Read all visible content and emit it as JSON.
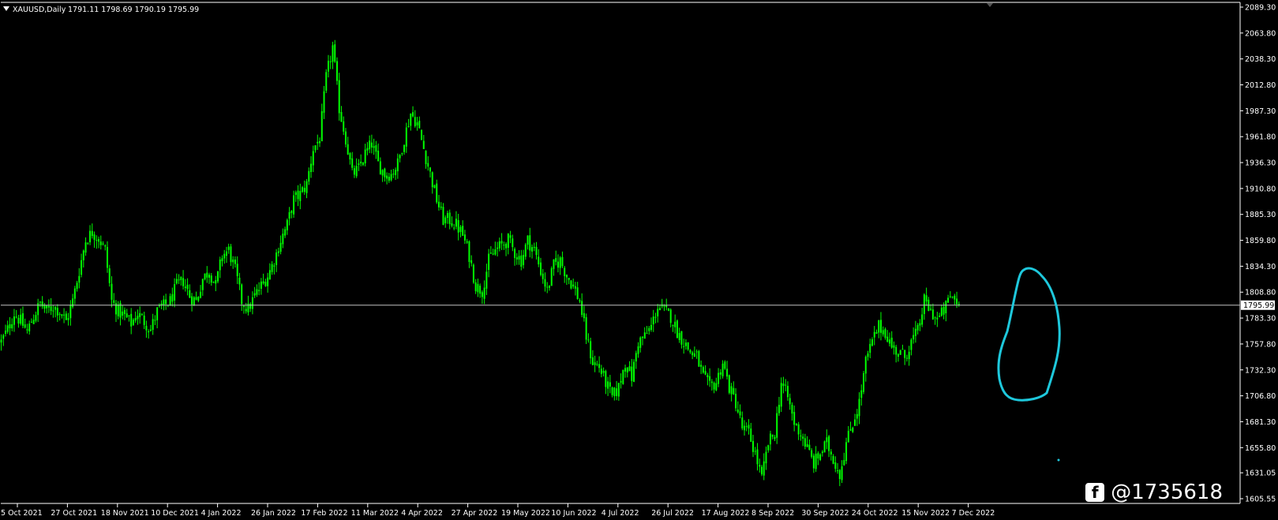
{
  "header": {
    "symbol_label": "XAUUSD,Daily",
    "ohlc": "1791.11 1798.69 1790.19 1795.99"
  },
  "watermark": {
    "text": "@1735618",
    "icon": "f"
  },
  "colors": {
    "background": "#000000",
    "candle": "#00ff00",
    "axis": "#ffffff",
    "current_line": "#c0c0c0",
    "drawing": "#1ec8dc",
    "price_box_bg": "#ffffff"
  },
  "chart_data": {
    "type": "candlestick",
    "symbol": "XAUUSD",
    "timeframe": "Daily",
    "current_price": 1795.99,
    "y_ticks": [
      "2089.30",
      "2063.80",
      "2038.30",
      "2012.80",
      "1987.30",
      "1961.80",
      "1936.30",
      "1910.80",
      "1885.30",
      "1859.80",
      "1834.30",
      "1808.80",
      "1783.30",
      "1757.80",
      "1732.30",
      "1706.80",
      "1681.30",
      "1655.80",
      "1631.05",
      "1605.55"
    ],
    "ylim": [
      1605.55,
      2089.3
    ],
    "x_ticks": [
      "5 Oct 2021",
      "27 Oct 2021",
      "18 Nov 2021",
      "10 Dec 2021",
      "4 Jan 2022",
      "26 Jan 2022",
      "17 Feb 2022",
      "11 Mar 2022",
      "4 Apr 2022",
      "27 Apr 2022",
      "19 May 2022",
      "10 Jun 2022",
      "4 Jul 2022",
      "26 Jul 2022",
      "17 Aug 2022",
      "8 Sep 2022",
      "30 Sep 2022",
      "24 Oct 2022",
      "15 Nov 2022",
      "7 Dec 2022"
    ],
    "close_path": [
      [
        0,
        1760
      ],
      [
        3,
        1772
      ],
      [
        6,
        1788
      ],
      [
        9,
        1780
      ],
      [
        12,
        1770
      ],
      [
        15,
        1785
      ],
      [
        18,
        1798
      ],
      [
        21,
        1790
      ],
      [
        24,
        1795
      ],
      [
        27,
        1790
      ],
      [
        30,
        1780
      ],
      [
        33,
        1800
      ],
      [
        36,
        1830
      ],
      [
        39,
        1860
      ],
      [
        42,
        1868
      ],
      [
        45,
        1862
      ],
      [
        48,
        1850
      ],
      [
        51,
        1800
      ],
      [
        54,
        1790
      ],
      [
        57,
        1785
      ],
      [
        60,
        1778
      ],
      [
        63,
        1788
      ],
      [
        66,
        1780
      ],
      [
        69,
        1772
      ],
      [
        72,
        1790
      ],
      [
        75,
        1795
      ],
      [
        78,
        1800
      ],
      [
        81,
        1815
      ],
      [
        84,
        1820
      ],
      [
        87,
        1805
      ],
      [
        90,
        1800
      ],
      [
        93,
        1822
      ],
      [
        96,
        1830
      ],
      [
        99,
        1815
      ],
      [
        102,
        1845
      ],
      [
        105,
        1850
      ],
      [
        108,
        1830
      ],
      [
        111,
        1800
      ],
      [
        114,
        1792
      ],
      [
        117,
        1805
      ],
      [
        120,
        1815
      ],
      [
        123,
        1825
      ],
      [
        126,
        1840
      ],
      [
        129,
        1860
      ],
      [
        132,
        1875
      ],
      [
        135,
        1900
      ],
      [
        138,
        1905
      ],
      [
        141,
        1915
      ],
      [
        144,
        1950
      ],
      [
        147,
        1960
      ],
      [
        150,
        2020
      ],
      [
        153,
        2050
      ],
      [
        156,
        1990
      ],
      [
        159,
        1960
      ],
      [
        162,
        1925
      ],
      [
        165,
        1930
      ],
      [
        168,
        1945
      ],
      [
        171,
        1955
      ],
      [
        174,
        1935
      ],
      [
        177,
        1925
      ],
      [
        180,
        1925
      ],
      [
        183,
        1935
      ],
      [
        186,
        1960
      ],
      [
        189,
        1985
      ],
      [
        192,
        1975
      ],
      [
        195,
        1950
      ],
      [
        198,
        1925
      ],
      [
        201,
        1900
      ],
      [
        204,
        1880
      ],
      [
        207,
        1880
      ],
      [
        210,
        1875
      ],
      [
        213,
        1865
      ],
      [
        216,
        1845
      ],
      [
        219,
        1815
      ],
      [
        222,
        1810
      ],
      [
        225,
        1840
      ],
      [
        228,
        1850
      ],
      [
        231,
        1855
      ],
      [
        234,
        1860
      ],
      [
        237,
        1848
      ],
      [
        240,
        1840
      ],
      [
        243,
        1860
      ],
      [
        246,
        1850
      ],
      [
        249,
        1830
      ],
      [
        252,
        1810
      ],
      [
        255,
        1835
      ],
      [
        258,
        1840
      ],
      [
        261,
        1825
      ],
      [
        264,
        1815
      ],
      [
        267,
        1800
      ],
      [
        270,
        1765
      ],
      [
        273,
        1740
      ],
      [
        276,
        1735
      ],
      [
        279,
        1720
      ],
      [
        282,
        1705
      ],
      [
        285,
        1715
      ],
      [
        288,
        1740
      ],
      [
        291,
        1725
      ],
      [
        294,
        1760
      ],
      [
        297,
        1765
      ],
      [
        300,
        1775
      ],
      [
        303,
        1795
      ],
      [
        306,
        1790
      ],
      [
        309,
        1785
      ],
      [
        312,
        1770
      ],
      [
        315,
        1760
      ],
      [
        318,
        1750
      ],
      [
        321,
        1745
      ],
      [
        324,
        1725
      ],
      [
        327,
        1715
      ],
      [
        330,
        1720
      ],
      [
        333,
        1740
      ],
      [
        336,
        1715
      ],
      [
        339,
        1700
      ],
      [
        342,
        1675
      ],
      [
        345,
        1670
      ],
      [
        348,
        1650
      ],
      [
        351,
        1625
      ],
      [
        354,
        1660
      ],
      [
        357,
        1670
      ],
      [
        360,
        1720
      ],
      [
        363,
        1705
      ],
      [
        366,
        1680
      ],
      [
        369,
        1670
      ],
      [
        372,
        1655
      ],
      [
        375,
        1640
      ],
      [
        378,
        1650
      ],
      [
        381,
        1660
      ],
      [
        384,
        1645
      ],
      [
        387,
        1630
      ],
      [
        390,
        1660
      ],
      [
        393,
        1680
      ],
      [
        396,
        1700
      ],
      [
        399,
        1740
      ],
      [
        402,
        1760
      ],
      [
        405,
        1775
      ],
      [
        408,
        1770
      ],
      [
        411,
        1755
      ],
      [
        414,
        1750
      ],
      [
        417,
        1745
      ],
      [
        420,
        1760
      ],
      [
        423,
        1770
      ],
      [
        426,
        1800
      ],
      [
        429,
        1790
      ],
      [
        432,
        1782
      ],
      [
        435,
        1790
      ],
      [
        438,
        1805
      ],
      [
        441,
        1800
      ],
      [
        442,
        1795.99
      ]
    ],
    "annotation": "hand-drawn cyan loop (freehand drawing)"
  }
}
